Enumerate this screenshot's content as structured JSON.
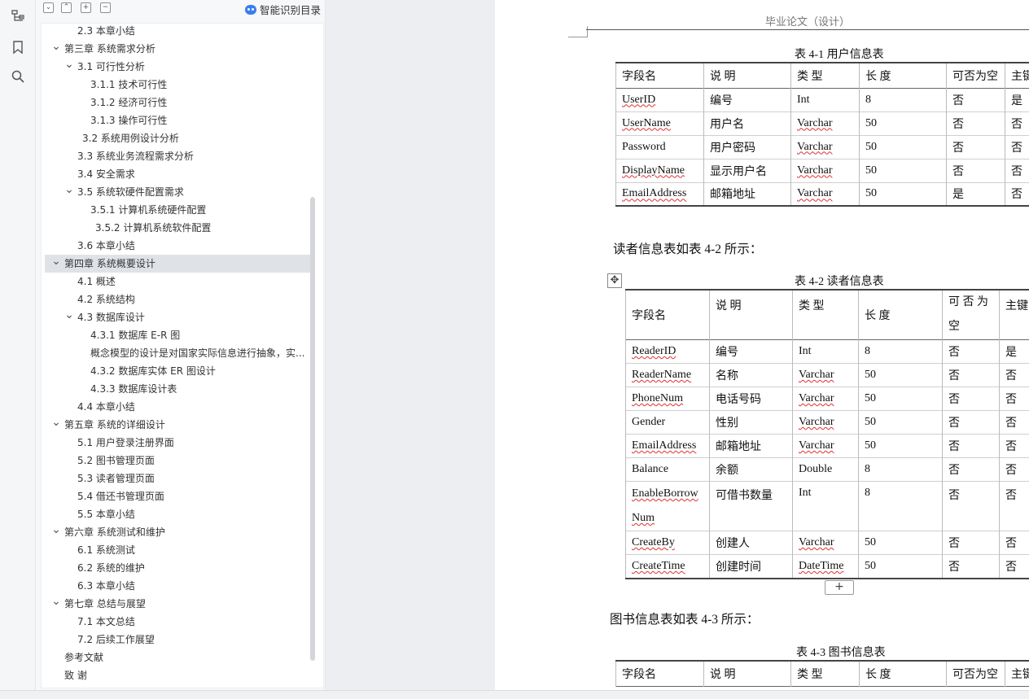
{
  "rail": {
    "icons": [
      "outline-icon",
      "bookmark-icon",
      "search-icon"
    ]
  },
  "nav": {
    "toolbar": {
      "collapse_label": "⌄",
      "expand_label": "⌃",
      "add_label": "+",
      "remove_label": "−",
      "smart_label": "智能识别目录"
    },
    "toc": [
      {
        "label": "2.3 本章小结",
        "level": 2
      },
      {
        "label": "第三章  系统需求分析",
        "level": 1,
        "arrow": "down"
      },
      {
        "label": "3.1 可行性分析",
        "level": 2,
        "arrow": "down"
      },
      {
        "label": "3.1.1 技术可行性",
        "level": 3
      },
      {
        "label": "3.1.2  经济可行性",
        "level": 3
      },
      {
        "label": "3.1.3 操作可行性",
        "level": 3
      },
      {
        "label": "3.2 系统用例设计分析",
        "level": 2.5
      },
      {
        "label": "3.3 系统业务流程需求分析",
        "level": 2
      },
      {
        "label": "3.4 安全需求",
        "level": 2
      },
      {
        "label": "3.5 系统软硬件配置需求",
        "level": 2,
        "arrow": "down"
      },
      {
        "label": "3.5.1 计算机系统硬件配置",
        "level": 3
      },
      {
        "label": "3.5.2 计算机系统软件配置",
        "level": 3.3
      },
      {
        "label": "3.6 本章小结",
        "level": 2
      },
      {
        "label": "第四章  系统概要设计",
        "level": 1,
        "arrow": "down",
        "selected": true
      },
      {
        "label": "4.1 概述",
        "level": 2
      },
      {
        "label": "4.2 系统结构",
        "level": 2
      },
      {
        "label": "4.3 数据库设计",
        "level": 2,
        "arrow": "down"
      },
      {
        "label": "4.3.1 数据库 E-R 图",
        "level": 3
      },
      {
        "label": "概念模型的设计是对国家实际信息进行抽象，实...",
        "level": 3
      },
      {
        "label": "4.3.2 数据库实体 ER 图设计",
        "level": 3
      },
      {
        "label": "4.3.3 数据库设计表",
        "level": 3
      },
      {
        "label": "4.4 本章小结",
        "level": 2
      },
      {
        "label": "第五章  系统的详细设计",
        "level": 1,
        "arrow": "down"
      },
      {
        "label": "5.1 用户登录注册界面",
        "level": 2
      },
      {
        "label": "5.2 图书管理页面",
        "level": 2
      },
      {
        "label": "5.3  读者管理页面",
        "level": 2
      },
      {
        "label": "5.4 借还书管理页面",
        "level": 2
      },
      {
        "label": "5.5 本章小结",
        "level": 2
      },
      {
        "label": "第六章  系统测试和维护",
        "level": 1,
        "arrow": "down"
      },
      {
        "label": "6.1 系统测试",
        "level": 2
      },
      {
        "label": "6.2 系统的维护",
        "level": 2
      },
      {
        "label": "6.3 本章小结",
        "level": 2
      },
      {
        "label": "第七章  总结与展望",
        "level": 1,
        "arrow": "down"
      },
      {
        "label": "7.1 本文总结",
        "level": 2
      },
      {
        "label": "7.2 后续工作展望",
        "level": 2
      },
      {
        "label": "参考文献",
        "level": 1
      },
      {
        "label": "致    谢",
        "level": 1
      }
    ]
  },
  "doc": {
    "header": "毕业论文（设计）",
    "table1": {
      "caption": "表 4-1  用户信息表",
      "headers": [
        "字段名",
        "说    明",
        "类    型",
        "长    度",
        "可否为空",
        "主键"
      ],
      "rows": [
        [
          "UserID",
          "编号",
          "Int",
          "8",
          "否",
          "是"
        ],
        [
          "UserName",
          "用户名",
          "Varchar",
          "50",
          "否",
          "否"
        ],
        [
          "Password",
          "用户密码",
          "Varchar",
          "50",
          "否",
          "否"
        ],
        [
          "DisplayName",
          "显示用户名",
          "Varchar",
          "50",
          "否",
          "否"
        ],
        [
          "EmailAddress",
          "邮箱地址",
          "Varchar",
          "50",
          "是",
          "否"
        ]
      ]
    },
    "para1": "读者信息表如表 4-2 所示：",
    "table2": {
      "caption": "表 4-2  读者信息表",
      "headers": [
        "字段名",
        "说    明",
        "类    型",
        "长    度",
        "可 否 为",
        "空",
        "主键"
      ],
      "rows": [
        [
          "ReaderID",
          "编号",
          "Int",
          "8",
          "否",
          "是"
        ],
        [
          "ReaderName",
          "名称",
          "Varchar",
          "50",
          "否",
          "否"
        ],
        [
          "PhoneNum",
          "电话号码",
          "Varchar",
          "50",
          "否",
          "否"
        ],
        [
          "Gender",
          "性别",
          "Varchar",
          "50",
          "否",
          "否"
        ],
        [
          "EmailAddress",
          "邮箱地址",
          "Varchar",
          "50",
          "否",
          "否"
        ],
        [
          "Balance",
          "余额",
          "Double",
          "8",
          "否",
          "否"
        ],
        [
          "EnableBorrow",
          "Num",
          "可借书数量",
          "Int",
          "8",
          "否",
          "否"
        ],
        [
          "CreateBy",
          "创建人",
          "Varchar",
          "50",
          "否",
          "否"
        ],
        [
          "CreateTime",
          "创建时间",
          "DateTime",
          "50",
          "否",
          "否"
        ]
      ],
      "move_handle": "✥",
      "add_row": "+"
    },
    "para2": "图书信息表如表 4-3 所示：",
    "table3": {
      "caption": "表 4-3 图书信息表",
      "headers": [
        "字段名",
        "说    明",
        "类    型",
        "长    度",
        "可否为空",
        "主键"
      ]
    }
  }
}
